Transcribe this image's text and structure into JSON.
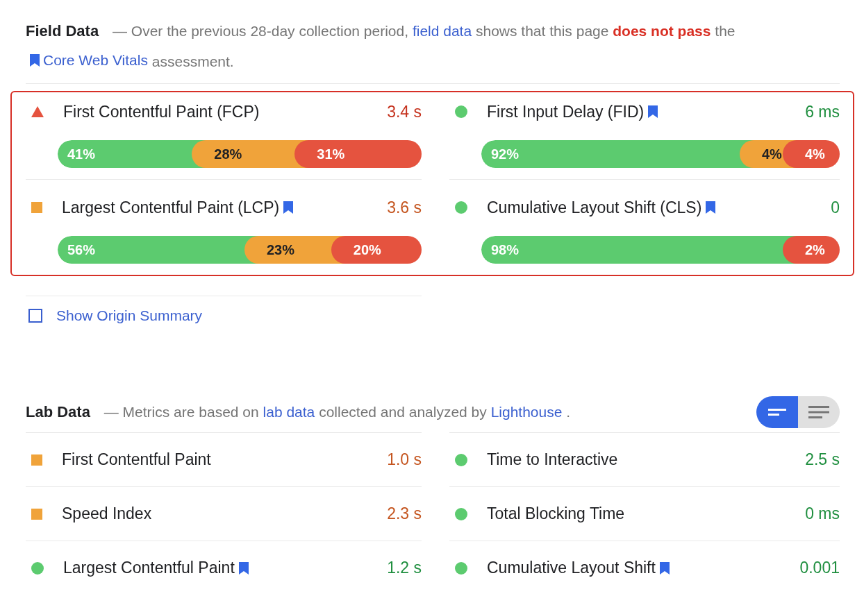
{
  "field": {
    "title": "Field Data",
    "description": [
      {
        "kind": "text",
        "text": "— Over the previous 28-day collection period,"
      },
      {
        "kind": "link",
        "text": "field data"
      },
      {
        "kind": "text",
        "text": "shows that this page"
      },
      {
        "kind": "alert",
        "text": "does not pass"
      },
      {
        "kind": "text",
        "text": "the"
      },
      {
        "kind": "doc-link",
        "text": "Core Web Vitals"
      },
      {
        "kind": "text",
        "text": "assessment."
      }
    ],
    "highlighted": true,
    "metrics": [
      {
        "name": "First Contentful Paint (FCP)",
        "kind": "fail",
        "info": false,
        "value": "3.4 s",
        "distribution": [
          {
            "kind": "good",
            "label": "41%"
          },
          {
            "kind": "average",
            "label": "28%"
          },
          {
            "kind": "poor",
            "label": "31%"
          }
        ]
      },
      {
        "name": "First Input Delay (FID)",
        "kind": "pass",
        "info": true,
        "value": "6 ms",
        "distribution": [
          {
            "kind": "good",
            "label": "92%"
          },
          {
            "kind": "average",
            "label": "4%"
          },
          {
            "kind": "poor",
            "label": "4%"
          }
        ]
      },
      {
        "name": "Largest Contentful Paint (LCP)",
        "kind": "average",
        "info": true,
        "value": "3.6 s",
        "distribution": [
          {
            "kind": "good",
            "label": "56%"
          },
          {
            "kind": "average",
            "label": "23%"
          },
          {
            "kind": "poor",
            "label": "20%"
          }
        ]
      },
      {
        "name": "Cumulative Layout Shift (CLS)",
        "kind": "pass",
        "info": true,
        "value": "0",
        "distribution": [
          {
            "kind": "good",
            "label": "98%"
          },
          {
            "kind": "poor",
            "label": "2%"
          }
        ]
      }
    ],
    "origin_summary": {
      "label": "Show Origin Summary",
      "checked": false
    }
  },
  "lab": {
    "title": "Lab Data",
    "description": [
      {
        "kind": "text",
        "text": "— Metrics are based on"
      },
      {
        "kind": "link",
        "text": "lab data"
      },
      {
        "kind": "text",
        "text": "collected and analyzed by"
      },
      {
        "kind": "link",
        "text": "Lighthouse"
      },
      {
        "kind": "text",
        "text": "."
      }
    ],
    "view_toggle": [
      {
        "kind": "compact",
        "selected": true
      },
      {
        "kind": "expanded",
        "selected": false
      }
    ],
    "metrics": [
      {
        "name": "First Contentful Paint",
        "kind": "average",
        "info": false,
        "value": "1.0 s"
      },
      {
        "name": "Time to Interactive",
        "kind": "pass",
        "info": false,
        "value": "2.5 s"
      },
      {
        "name": "Speed Index",
        "kind": "average",
        "info": false,
        "value": "2.3 s"
      },
      {
        "name": "Total Blocking Time",
        "kind": "pass",
        "info": false,
        "value": "0 ms"
      },
      {
        "name": "Largest Contentful Paint",
        "kind": "pass",
        "info": true,
        "value": "1.2 s"
      },
      {
        "name": "Cumulative Layout Shift",
        "kind": "pass",
        "info": true,
        "value": "0.001"
      }
    ]
  }
}
